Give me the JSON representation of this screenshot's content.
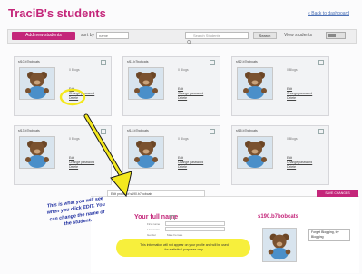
{
  "header": {
    "title": "TraciB's students",
    "back_link": "« Back to dashboard"
  },
  "toolbar": {
    "add_button": "Add new students",
    "sort_label": "sort by",
    "sort_value": "name",
    "search_placeholder": "Search Students",
    "search_button": "Search",
    "view_label": "View students"
  },
  "cards": [
    {
      "name": "sf10.b7bobcats",
      "blogs": "0 Blogs",
      "edit": "Edit",
      "change_password": "Change password",
      "delete": "Delete"
    },
    {
      "name": "sf11.b7bobcats",
      "blogs": "0 Blogs",
      "edit": "Edit",
      "change_password": "Change password",
      "delete": "Delete"
    },
    {
      "name": "sf12.b7bobcats",
      "blogs": "0 Blogs",
      "edit": "Edit",
      "change_password": "Change password",
      "delete": "Delete"
    },
    {
      "name": "sf13.b7bobcats",
      "blogs": "0 Blogs",
      "edit": "Edit",
      "change_password": "Change password",
      "delete": "Delete"
    },
    {
      "name": "sf14.b7bobcats",
      "blogs": "0 Blogs",
      "edit": "Edit",
      "change_password": "Change password",
      "delete": "Delete"
    },
    {
      "name": "sf15.b7bobcats",
      "blogs": "0 Blogs",
      "edit": "Edit",
      "change_password": "Change password",
      "delete": "Delete"
    }
  ],
  "detail": {
    "profile_strip": "Edit profile of s190.b7bobcats",
    "save_button": "SAVE CHANGES",
    "fullname_title": "Your full name",
    "first_name_label": "First name",
    "last_name_label": "Last name",
    "gender_label": "Gender",
    "gender_value": "Male  Female",
    "notice_line1": "This information will not appear on your profile and will be used",
    "notice_line2": "for statistical purposes only.",
    "side_username": "s190.b7bobcats",
    "side_blog": "Forget Blogging, try Blogging"
  },
  "annotation": {
    "line1": "This is what you will see",
    "line2": "when you click EDIT. You",
    "line3": "can change the name of",
    "line4": "the student."
  },
  "colors": {
    "brand": "#c4267a",
    "highlight": "#f7ef3c",
    "annotation": "#1f2fa0"
  }
}
